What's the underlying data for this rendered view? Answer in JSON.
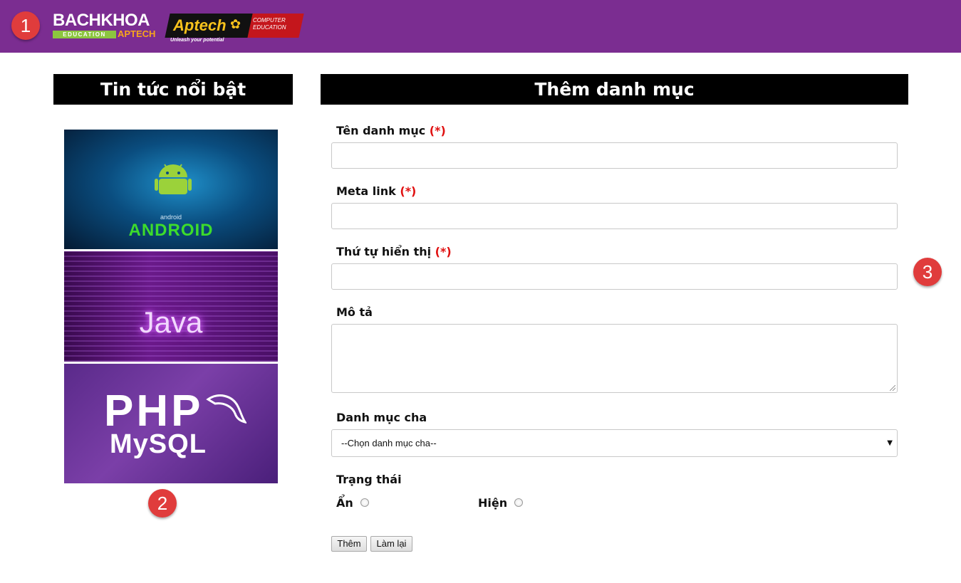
{
  "header": {
    "step1": "1",
    "logo_bachkhoa": {
      "main": "BACHKHOA",
      "education": "EDUCATION",
      "aptech": "APTECH"
    },
    "logo_aptech": {
      "word": "Aptech",
      "computer_education": "COMPUTER EDUCATION",
      "tagline": "Unleash your potential"
    },
    "colors": {
      "background": "#7b2d91",
      "badge": "#e03c3c"
    }
  },
  "sidebar": {
    "title": "Tin tức nổi bật",
    "step2": "2",
    "thumbs": [
      {
        "small": "android",
        "big": "ANDROID"
      },
      {
        "word": "Java"
      },
      {
        "php": "PHP",
        "mysql": "MySQL"
      }
    ]
  },
  "form": {
    "title": "Thêm danh mục",
    "step3": "3",
    "required_mark": "(*)",
    "fields": {
      "name_label": "Tên danh mục",
      "meta_label": "Meta link",
      "order_label": "Thứ tự hiển thị",
      "desc_label": "Mô tả",
      "parent_label": "Danh mục cha",
      "parent_selected": "--Chọn danh mục cha--",
      "status_label": "Trạng thái",
      "status_hidden": "Ẩn",
      "status_shown": "Hiện"
    },
    "buttons": {
      "add": "Thêm",
      "reset": "Làm lại"
    }
  }
}
